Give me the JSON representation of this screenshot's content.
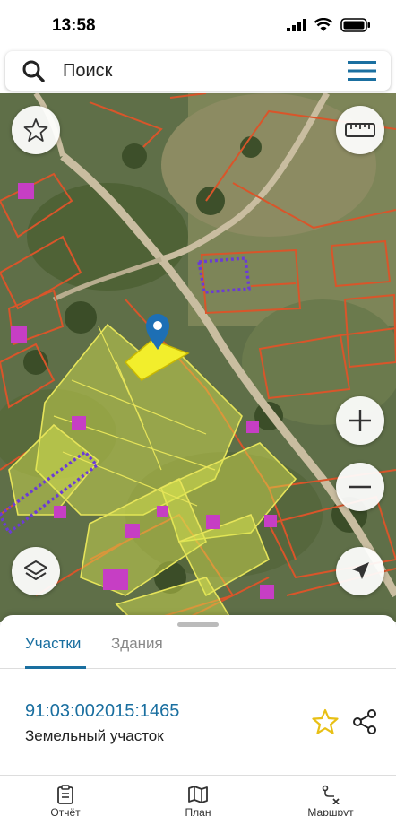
{
  "status": {
    "time": "13:58"
  },
  "search": {
    "placeholder": "Поиск"
  },
  "sheet": {
    "tabs": [
      {
        "label": "Участки",
        "active": true
      },
      {
        "label": "Здания",
        "active": false
      }
    ],
    "parcel": {
      "number": "91:03:002015:1465",
      "type": "Земельный участок"
    }
  },
  "bottom_nav": [
    {
      "label": "Отчёт",
      "icon": "clipboard-icon"
    },
    {
      "label": "План",
      "icon": "map-icon"
    },
    {
      "label": "Маршрут",
      "icon": "route-icon"
    }
  ],
  "colors": {
    "accent": "#1a6fa0",
    "parcel_border": "#d9552a",
    "selected_parcel": "#f2ee2c",
    "building_marker": "#c63ec4",
    "favorite_star": "#e8c016"
  }
}
